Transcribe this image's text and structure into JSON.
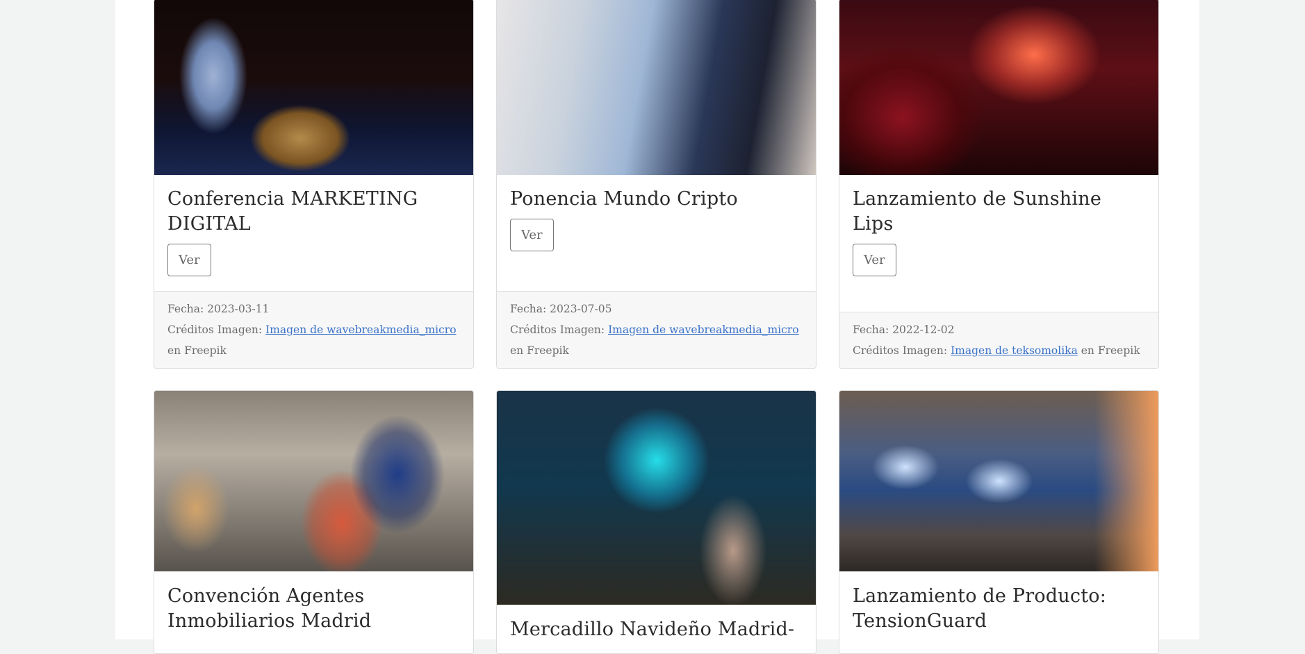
{
  "cards": [
    {
      "title": "Conferencia MARKETING DIGITAL",
      "button_label": "Ver",
      "date_text": "Fecha: 2023-03-11",
      "credits_prefix": "Créditos Imagen:",
      "credits_link": "Imagen de wavebreakmedia_micro",
      "credits_suffix": "en Freepik"
    },
    {
      "title": "Ponencia Mundo Cripto",
      "button_label": "Ver",
      "date_text": "Fecha: 2023-07-05",
      "credits_prefix": "Créditos Imagen:",
      "credits_link": "Imagen de wavebreakmedia_micro",
      "credits_suffix": "en Freepik"
    },
    {
      "title": "Lanzamiento de Sunshine Lips",
      "button_label": "Ver",
      "date_text": "Fecha: 2022-12-02",
      "credits_prefix": "Créditos Imagen:",
      "credits_link": "Imagen de teksomolika",
      "credits_suffix": "en Freepik"
    },
    {
      "title": "Convención Agentes Inmobiliarios Madrid"
    },
    {
      "title": "Mercadillo Navideño Madrid-"
    },
    {
      "title": "Lanzamiento de Producto: TensionGuard"
    }
  ]
}
